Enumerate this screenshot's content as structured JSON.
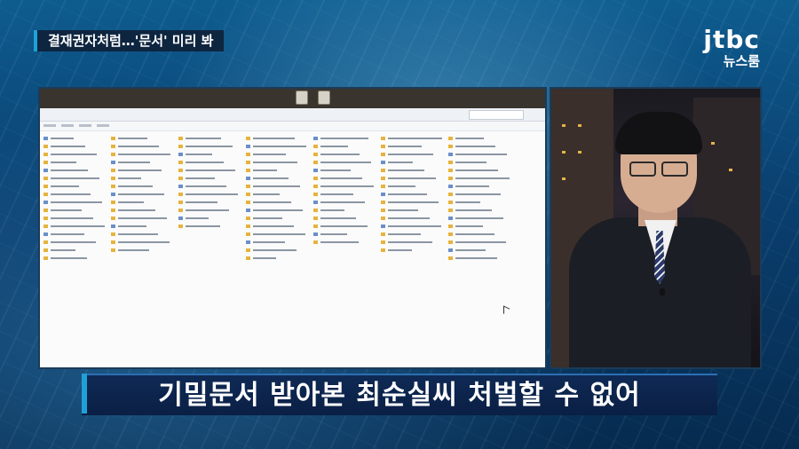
{
  "topic_bar": {
    "text": "결재권자처럼…'문서' 미리 봐"
  },
  "logo": {
    "brand": "jtbc",
    "sub": "뉴스룸"
  },
  "subtitle": {
    "text": "기밀문서 받아본 최순실씨 처벌할 수 없어"
  },
  "left_video": {
    "description_icon": "file-explorer-window"
  },
  "right_video": {
    "description_icon": "reporter"
  },
  "colors": {
    "accent": "#1fa1d8",
    "subtitle_bg": "#0a1f44",
    "topic_bg": "#0e2540"
  }
}
